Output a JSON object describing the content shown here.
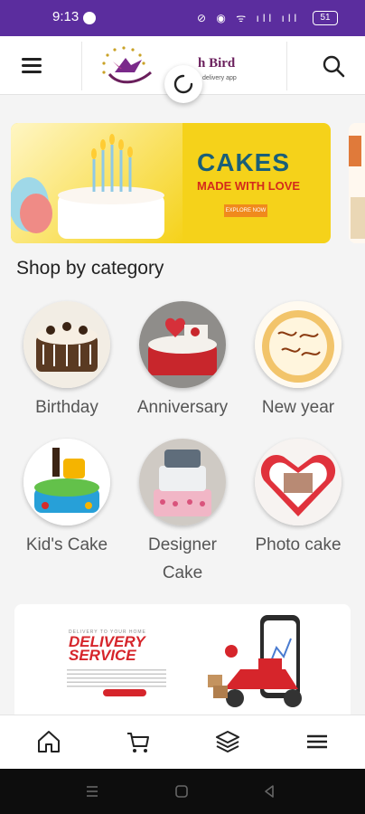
{
  "status_bar": {
    "time": "9:13",
    "icons": "⊘ ◉ ᯤ ıll ıll",
    "battery": "51"
  },
  "header": {
    "logo_title": "h Bird",
    "logo_subtitle": "delivery app",
    "menu_icon": "hamburger-icon",
    "search_icon": "search-icon"
  },
  "banner": {
    "title": "CAKES",
    "tagline": "MADE WITH LOVE",
    "cta": "EXPLORE NOW"
  },
  "section_title": "Shop by category",
  "categories": [
    {
      "label": "Birthday"
    },
    {
      "label": "Anniversary"
    },
    {
      "label": "New year"
    },
    {
      "label": "Kid's Cake"
    },
    {
      "label": "Designer Cake"
    },
    {
      "label": "Photo cake"
    }
  ],
  "promo": {
    "small_heading": "DELIVERY TO YOUR HOME",
    "line1": "DELIVERY",
    "line2": "SERVICE"
  },
  "bottom_nav": [
    "home-icon",
    "cart-icon",
    "layers-icon",
    "menu-icon"
  ],
  "colors": {
    "status_bar": "#5b2d9e",
    "banner_bg": "#f5d21a",
    "banner_title": "#1a5f78",
    "accent_red": "#d42a1c"
  }
}
